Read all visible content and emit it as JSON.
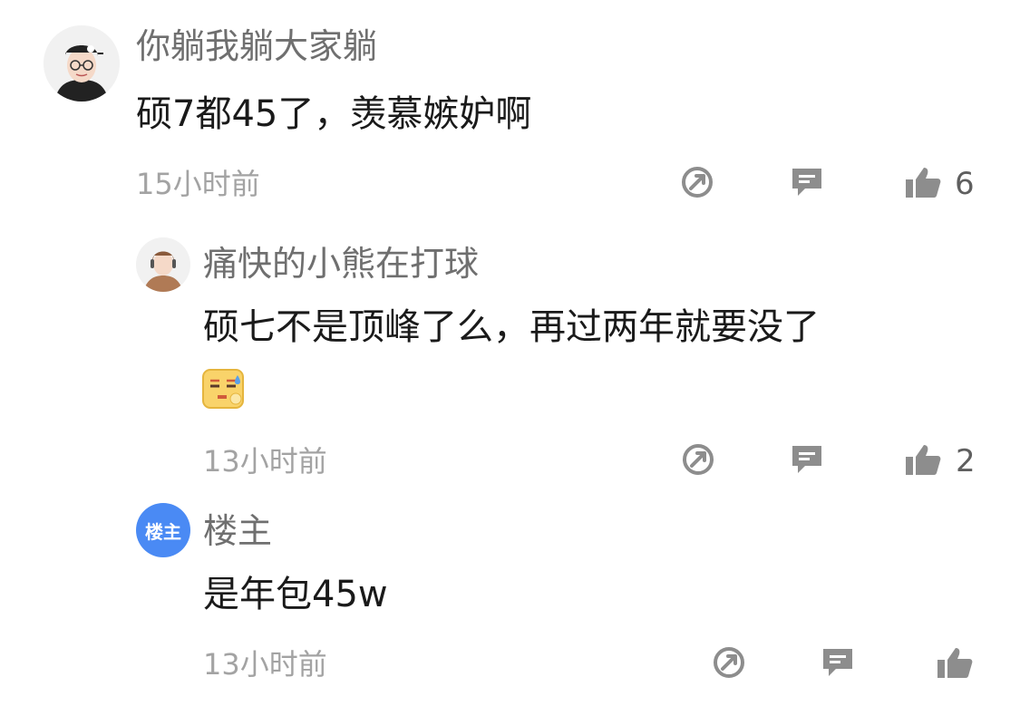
{
  "comments": [
    {
      "username": "你躺我躺大家躺",
      "text": "硕7都45了，羡慕嫉妒啊",
      "time": "15小时前",
      "likes": "6"
    },
    {
      "username": "痛快的小熊在打球",
      "text": "硕七不是顶峰了么，再过两年就要没了",
      "emoji": "sweat-smile-emoji",
      "time": "13小时前",
      "likes": "2"
    },
    {
      "avatar_label": "楼主",
      "username": "楼主",
      "text": "是年包45w",
      "time": "13小时前",
      "likes": ""
    }
  ],
  "icons": [
    "share-icon",
    "reply-icon",
    "like-icon"
  ],
  "colors": {
    "accent_blue": "#4a8af4",
    "icon_gray": "#8d8d8d",
    "text_gray": "#6f6f6f"
  }
}
